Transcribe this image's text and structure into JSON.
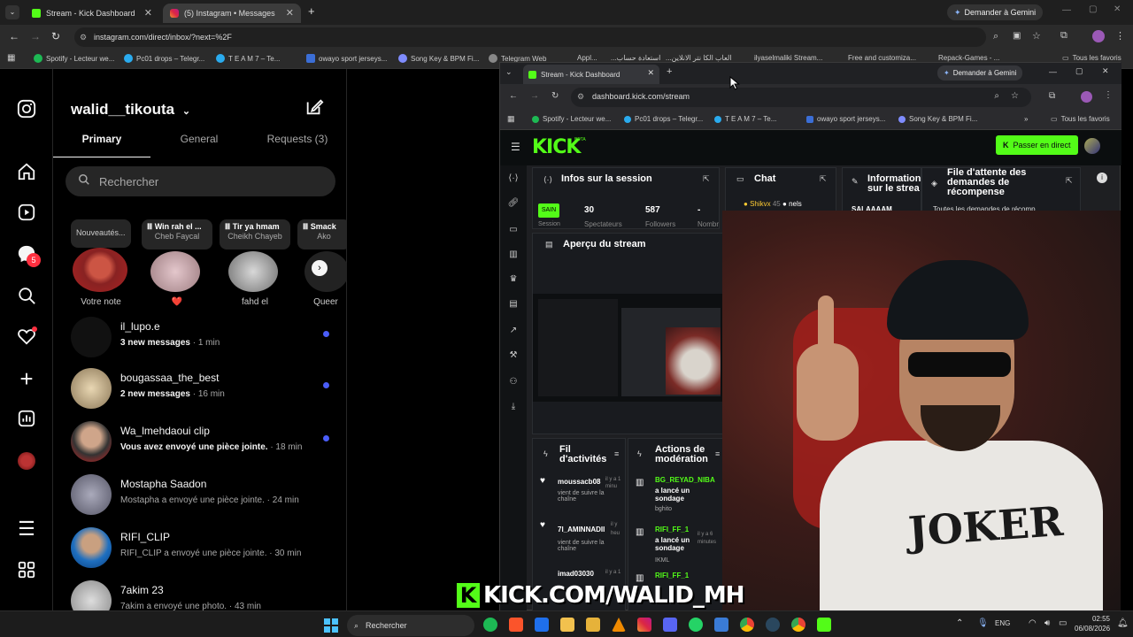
{
  "browser": {
    "tabs": [
      {
        "title": "Stream - Kick Dashboard",
        "active": false
      },
      {
        "title": "(5) Instagram • Messages",
        "active": true
      }
    ],
    "gemini_label": "Demander à Gemini",
    "url": "instagram.com/direct/inbox/?next=%2F",
    "bookmarks": [
      "Spotify - Lecteur we...",
      "Pc01 drops – Telegr...",
      "T E A M 7 – Te...",
      "owayo sport jerseys...",
      "Song Key & BPM Fi...",
      "Telegram Web",
      "Appl...",
      "...استعادة حساب",
      "...العاب الكا نتر الانلاين",
      "ilyaselmaliki Stream...",
      "Free and customiza...",
      "Repack-Games - ...",
      "Tous les favoris"
    ]
  },
  "instagram": {
    "username": "walid__tikouta",
    "tabs": {
      "primary": "Primary",
      "general": "General",
      "requests": "Requests (3)"
    },
    "search_placeholder": "Rechercher",
    "notes": [
      {
        "bubble": "Nouveautés...",
        "name": "Votre note"
      },
      {
        "bubble": "Win rah el ...",
        "sub": "Cheb Faycal",
        "name": "❤️"
      },
      {
        "bubble": "Tir ya hmam",
        "sub": "Cheikh Chayeb",
        "name": "fahd el"
      },
      {
        "bubble": "Smack",
        "sub": "Ako",
        "name": "Queer"
      }
    ],
    "conversations": [
      {
        "name": "il_lupo.e",
        "snippet": "3 new messages",
        "time": "· 1 min",
        "unread": true
      },
      {
        "name": "bougassaa_the_best",
        "snippet": "2 new messages",
        "time": "· 16 min",
        "unread": true
      },
      {
        "name": "Wa_lmehdaoui clip",
        "snippet": "Vous avez envoyé une pièce jointe.",
        "time": "· 18 min",
        "unread": true
      },
      {
        "name": "Mostapha Saadon",
        "snippet": "Mostapha a envoyé une pièce jointe.",
        "time": "· 24 min",
        "unread": false
      },
      {
        "name": "RIFI_CLIP",
        "snippet": "RIFI_CLIP a envoyé une pièce jointe.",
        "time": "· 30 min",
        "unread": false
      },
      {
        "name": "7akim 23",
        "snippet": "7akim a envoyé une photo.",
        "time": "· 43 min",
        "unread": false
      }
    ],
    "badge": "5"
  },
  "kick": {
    "tab_title": "Stream - Kick Dashboard",
    "gemini_label": "Demander à Gemini",
    "url": "dashboard.kick.com/stream",
    "bookmarks": [
      "Spotify - Lecteur we...",
      "Pc01 drops – Telegr...",
      "T E A M 7 – Te...",
      "owayo sport jerseys...",
      "Song Key & BPM Fi...",
      "Tous les favoris"
    ],
    "logo": "KICK",
    "logo_sup": "BETA",
    "go_live": "Passer en direct",
    "session": {
      "title": "Infos sur la session",
      "status": "SAIN",
      "status_sub": "Session",
      "viewers": "30",
      "viewers_label": "Spectateurs",
      "followers": "587",
      "followers_label": "Followers",
      "dash": "-",
      "dash_label": "Nombre"
    },
    "chat": {
      "title": "Chat",
      "user1": "Shikvx",
      "user1_num": "45",
      "user2": "nels"
    },
    "info": {
      "title": "Informations sur le strea",
      "body": "SALAAAAM"
    },
    "rewards": {
      "title": "File d'attente des demandes de récompense",
      "body": "Toutes les demandes de récomp..."
    },
    "preview_title": "Aperçu du stream",
    "activity": {
      "title": "Fil d'activités",
      "items": [
        {
          "user": "moussacb08",
          "text": "vient de suivre la chaîne",
          "time": "il y a 1 minu"
        },
        {
          "user": "7l_AMINNADII",
          "text": "vient de suivre la chaîne",
          "time": "il y heu"
        },
        {
          "user": "imad03030",
          "text": "",
          "time": "il y a 1"
        }
      ]
    },
    "moderation": {
      "title": "Actions de modération",
      "items": [
        {
          "user": "BG_REYAD_NIBA",
          "text": "a lancé un sondage",
          "sub": "bghito",
          "time": ""
        },
        {
          "user": "RIFI_FF_1",
          "text": "a lancé un sondage",
          "sub": "IKML",
          "time": "il y a 6 minutes"
        },
        {
          "user": "RIFI_FF_1",
          "text": "",
          "sub": "",
          "time": ""
        }
      ]
    }
  },
  "overlay": {
    "text": "KICK.COM/WALID_MH",
    "shirt": "JOKER"
  },
  "taskbar": {
    "search": "Rechercher",
    "lang": "ENG",
    "time": "02:55",
    "date": "06/08/2026"
  },
  "colors": {
    "kick_green": "#53fc18",
    "ig_unread": "#4a5df9",
    "ig_badge": "#ff3040"
  }
}
